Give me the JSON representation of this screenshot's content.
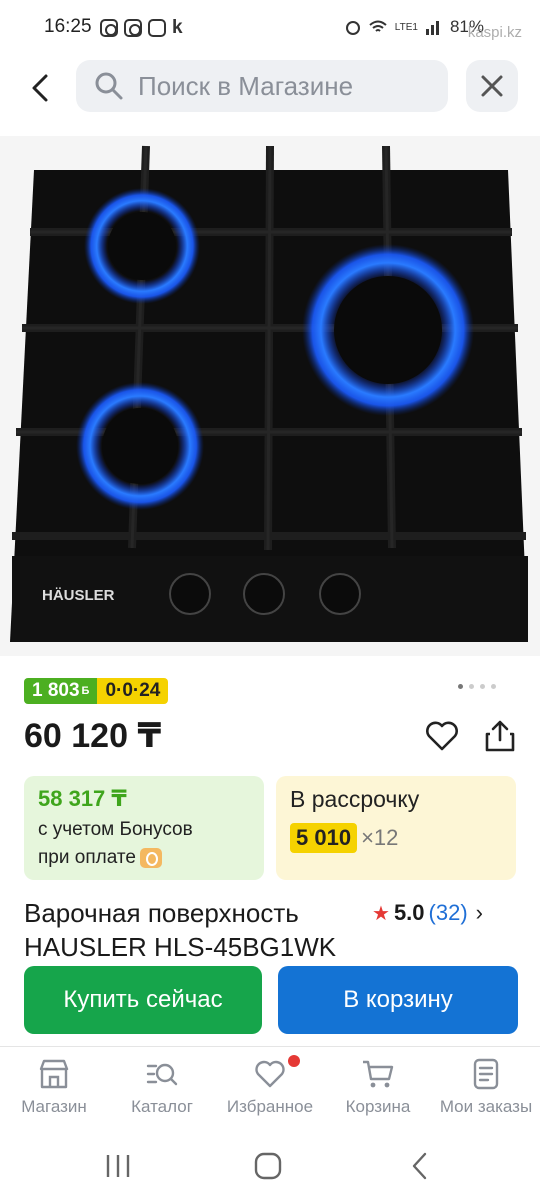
{
  "status_bar": {
    "time": "16:25",
    "app_letter": "k",
    "battery": "81%",
    "network": "LTE1",
    "watermark": "kaspi.kz"
  },
  "search": {
    "placeholder": "Поиск в Магазине"
  },
  "product": {
    "brand_logo": "HÄUSLER",
    "bonus_points": "1 803",
    "bonus_suffix": "Б",
    "installment_badge": "0·0·24",
    "price": "60 120 ₸",
    "bonus_card": {
      "amount": "58 317 ₸",
      "line1": "с учетом Бонусов",
      "line2": "при оплате"
    },
    "installment_card": {
      "title": "В рассрочку",
      "monthly": "5 010",
      "months": "×12"
    },
    "title": "Варочная поверхность HAUSLER HLS-45BG1WK",
    "rating_score": "5.0",
    "rating_count": "(32)",
    "image_pages": 4,
    "image_active_page": 1
  },
  "actions": {
    "buy_now": "Купить сейчас",
    "add_to_cart": "В корзину"
  },
  "bottom_nav": [
    {
      "label": "Магазин",
      "icon": "store-icon"
    },
    {
      "label": "Каталог",
      "icon": "catalog-icon"
    },
    {
      "label": "Избранное",
      "icon": "heart-icon"
    },
    {
      "label": "Корзина",
      "icon": "cart-icon"
    },
    {
      "label": "Мои заказы",
      "icon": "orders-icon"
    }
  ],
  "colors": {
    "green": "#16a54b",
    "blue": "#1473d4",
    "bonus_green": "#4caf21",
    "yellow": "#f5d200",
    "red": "#e53935"
  }
}
